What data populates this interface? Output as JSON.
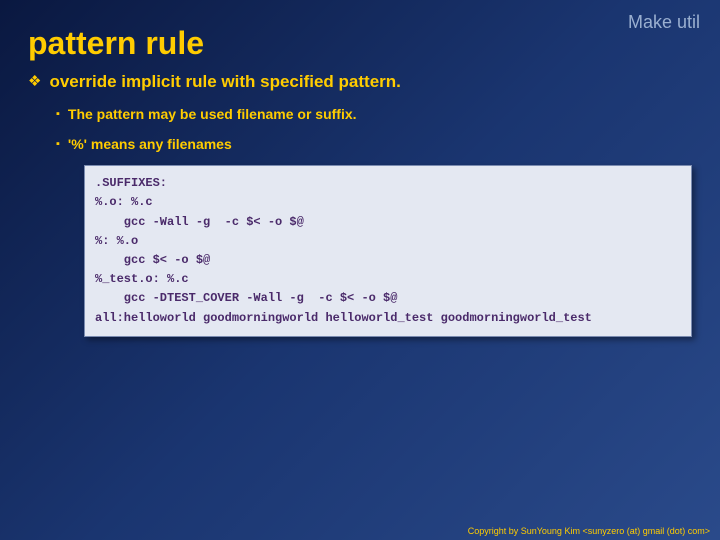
{
  "topLabel": "Make util",
  "title": "pattern rule",
  "main": {
    "heading": "override implicit rule with specified pattern.",
    "bullets": [
      "The pattern may be used filename or suffix.",
      "'%' means any filenames"
    ]
  },
  "code": ".SUFFIXES:\n%.o: %.c\n    gcc -Wall -g  -c $< -o $@\n%: %.o\n    gcc $< -o $@\n%_test.o: %.c\n    gcc -DTEST_COVER -Wall -g  -c $< -o $@\nall:helloworld goodmorningworld helloworld_test goodmorningworld_test",
  "footer": "Copyright by SunYoung Kim <sunyzero (at) gmail (dot) com>"
}
